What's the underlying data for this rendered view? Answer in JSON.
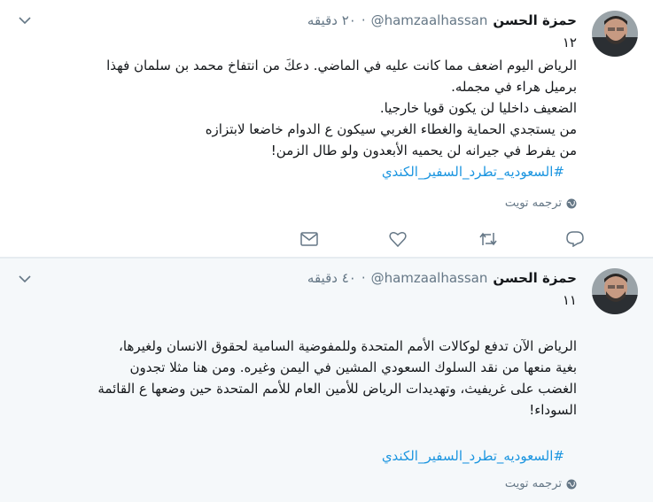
{
  "tweets": [
    {
      "author_name": "حمزة الحسن",
      "handle": "@hamzaalhassan",
      "separator": "·",
      "time": "٢٠ دقيقه",
      "thread_number": "١٢",
      "lines": [
        "الرياض اليوم اضعف مما كانت عليه في الماضي. دعكَ من انتفاخ محمد بن سلمان فهذا",
        "برميل هراء في مجمله.",
        "الضعيف داخليا لن يكون قويا خارجيا.",
        "من يستجدي الحماية والغطاء الغربي سيكون ع الدوام خاضعا لابتزازه",
        "من يفرط في جيرانه لن يحميه الأبعدون ولو طال الزمن!"
      ],
      "hashtag": "#السعوديه_تطرد_السفير_الكندي",
      "translate_label": "ترجمه تويت"
    },
    {
      "author_name": "حمزة الحسن",
      "handle": "@hamzaalhassan",
      "separator": "·",
      "time": "٤٠ دقيقه",
      "thread_number": "١١",
      "lines": [
        "الرياض الآن تدفع لوكالات الأمم المتحدة وللمفوضية السامية لحقوق الانسان ولغيرها،",
        "بغية منعها من نقد السلوك السعودي المشين في اليمن وغيره. ومن هنا مثلا تجدون",
        "الغضب على غريفيث، وتهديدات الرياض للأمين العام للأمم المتحدة حين وضعها ع القائمة",
        "السوداء!"
      ],
      "hashtag": "#السعوديه_تطرد_السفير_الكندي",
      "translate_label": "ترجمه تويت"
    }
  ],
  "colors": {
    "link": "#1b95e0",
    "muted": "#657786",
    "text": "#14171a"
  },
  "icons": [
    "globe-icon",
    "reply-icon",
    "retweet-icon",
    "like-icon",
    "dm-icon",
    "chevron-down-icon"
  ]
}
